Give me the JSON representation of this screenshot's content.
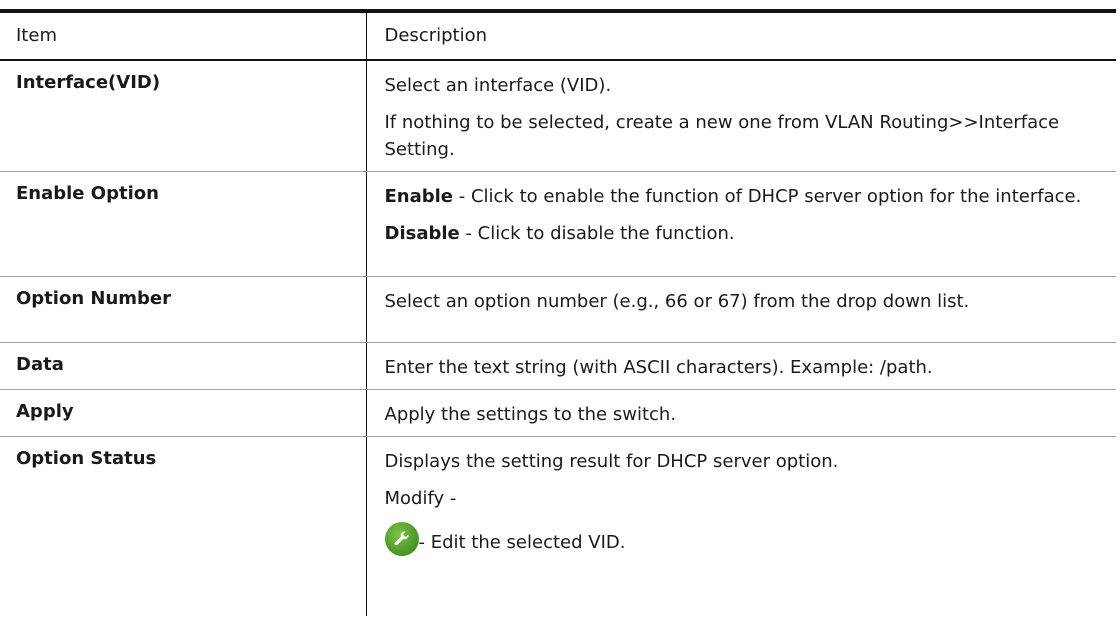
{
  "table": {
    "headers": {
      "item": "Item",
      "description": "Description"
    },
    "rows": [
      {
        "item": "Interface(VID)",
        "desc": [
          "Select an interface (VID).",
          "If nothing to be selected, create a new one from VLAN Routing>>Interface Setting."
        ]
      },
      {
        "item": "Enable Option",
        "enable_label": "Enable",
        "enable_text": " - Click to enable the function of DHCP server option for the interface.",
        "disable_label": "Disable",
        "disable_text": " - Click to disable the function."
      },
      {
        "item": "Option Number",
        "desc": [
          "Select an option number (e.g., 66 or 67) from the drop down list."
        ]
      },
      {
        "item": "Data",
        "desc": [
          "Enter the text string (with ASCII characters). Example: /path."
        ]
      },
      {
        "item": "Apply",
        "desc": [
          "Apply the settings to the switch."
        ]
      },
      {
        "item": "Option Status",
        "desc": [
          "Displays the setting result for DHCP server option.",
          "Modify -"
        ],
        "edit_text": "- Edit the selected VID.",
        "icon": "wrench-icon"
      }
    ]
  }
}
